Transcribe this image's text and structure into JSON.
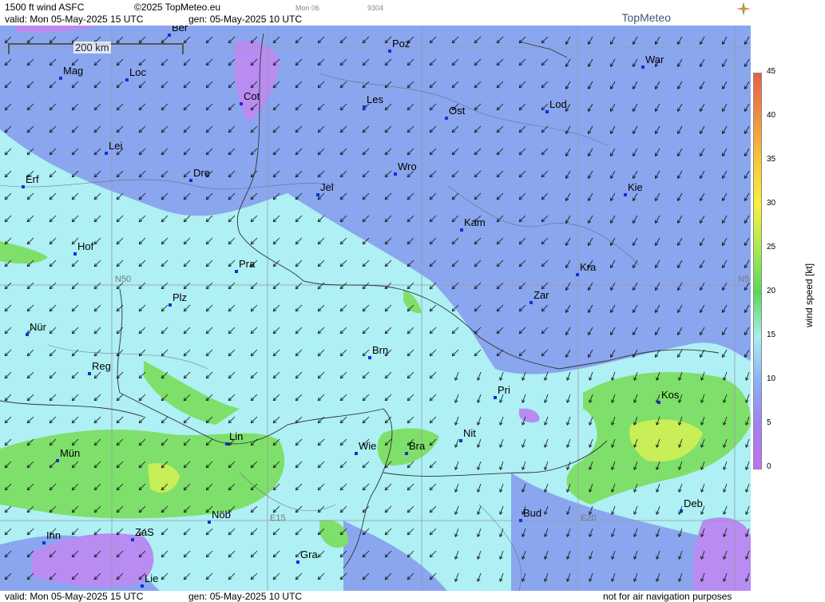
{
  "header": {
    "title": "1500 ft wind ASFC",
    "copyright": "©2025 TopMeteo.eu",
    "small_day": "Mon 06",
    "small_code": "9304",
    "valid": "valid:  Mon  05-May-2025  15 UTC",
    "gen": "gen:  05-May-2025 10 UTC",
    "logo": "TopMeteo"
  },
  "footer": {
    "valid": "valid:  Mon  05-May-2025  15 UTC",
    "gen": "gen:  05-May-2025 10 UTC",
    "disclaimer": "not for air navigation purposes"
  },
  "map": {
    "scale_label": "200 km",
    "grid_labels": [
      "N50",
      "N5",
      "E15",
      "E20"
    ],
    "cities": [
      "Ber",
      "Poz",
      "War",
      "Mag",
      "Loc",
      "Cot",
      "Les",
      "Ost",
      "Lod",
      "Lei",
      "Erf",
      "Dre",
      "Jel",
      "Wro",
      "Kie",
      "Kam",
      "Hof",
      "Pra",
      "Kra",
      "Plz",
      "Zar",
      "Nür",
      "Brn",
      "Reg",
      "Pri",
      "Kos",
      "Lin",
      "Nit",
      "Wie",
      "Bra",
      "Mün",
      "Deb",
      "Bud",
      "Nöb",
      "Inn",
      "ZaS",
      "Gra",
      "Lie"
    ]
  },
  "legend": {
    "title": "wind speed [kt]",
    "ticks": [
      "45",
      "40",
      "35",
      "30",
      "25",
      "20",
      "15",
      "10",
      "5",
      "0"
    ],
    "colors": [
      "#e86048",
      "#f09040",
      "#f8c838",
      "#f8f040",
      "#a8e850",
      "#58d858",
      "#a8f0f0",
      "#8ab0f8",
      "#a080f0",
      "#c070f0"
    ]
  },
  "colors": {
    "lowwind": "#8aa6ee",
    "midwind": "#aef0f4",
    "highwind": "#7ee06a",
    "calm": "#b88cf0",
    "city_marker": "#1530d8"
  }
}
